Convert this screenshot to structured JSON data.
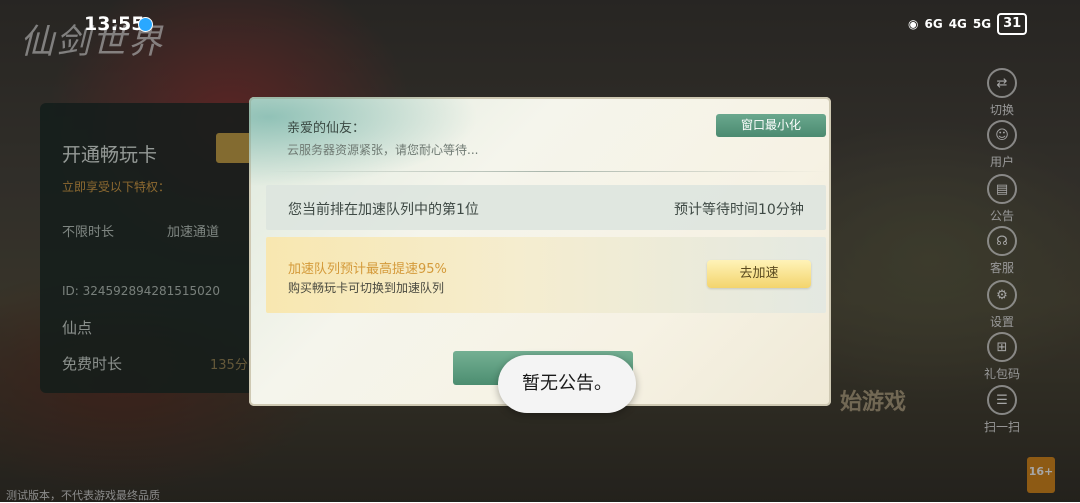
{
  "status_bar": {
    "time": "13:55",
    "network_1": "6G",
    "network_2": "4G",
    "network_3": "5G",
    "battery": "31"
  },
  "game": {
    "logo_text": "仙剑世界",
    "start_label": "始游戏",
    "footer_note": "测试版本，不代表游戏最终品质",
    "age_rating": "16+"
  },
  "left_card": {
    "title": "开通畅玩卡",
    "subtitle": "立即享受以下特权：",
    "col1": "不限时长",
    "col2": "加速通道",
    "id_text": "ID: 324592894281515020",
    "row1_label": "仙点",
    "row2_label": "免费时长",
    "row2_value": "135分"
  },
  "side_menu": [
    {
      "label": "切换",
      "icon": "switch-icon",
      "glyph": "⇄"
    },
    {
      "label": "用户",
      "icon": "user-icon",
      "glyph": "☺"
    },
    {
      "label": "公告",
      "icon": "notice-icon",
      "glyph": "▤"
    },
    {
      "label": "客服",
      "icon": "headset-icon",
      "glyph": "☊"
    },
    {
      "label": "设置",
      "icon": "gear-icon",
      "glyph": "⚙"
    },
    {
      "label": "礼包码",
      "icon": "gift-icon",
      "glyph": "⊞"
    },
    {
      "label": "扫一扫",
      "icon": "scan-icon",
      "glyph": "☰"
    }
  ],
  "dialog": {
    "greeting": "亲爱的仙友：",
    "busy_text": "云服务器资源紧张，请您耐心等待...",
    "minimize_label": "窗口最小化",
    "queue_position": "您当前排在加速队列中的第1位",
    "estimated_wait": "预计等待时间10分钟",
    "boost_title": "加速队列预计最高提速95%",
    "boost_desc": "购买畅玩卡可切换到加速队列",
    "boost_button": "去加速"
  },
  "toast": {
    "text": "暂无公告。"
  },
  "colors": {
    "accent_green": "#5a9a80",
    "boost_gold": "#f3d46d",
    "boost_text": "#d49a3a"
  }
}
